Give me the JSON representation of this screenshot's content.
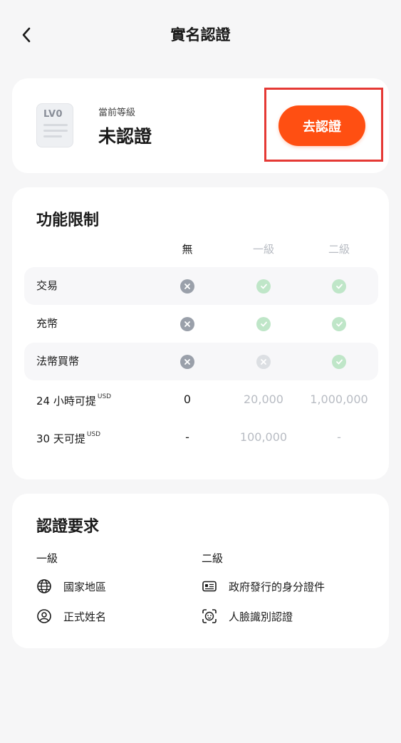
{
  "header": {
    "title": "實名認證"
  },
  "level_card": {
    "badge": "LV0",
    "current_label": "當前等級",
    "current_value": "未認證",
    "verify_button": "去認證",
    "colors": {
      "accent": "#ff4f12",
      "highlight": "#e53935"
    }
  },
  "limits": {
    "title": "功能限制",
    "columns": [
      "無",
      "一級",
      "二級"
    ],
    "rows": [
      {
        "label": "交易",
        "values": [
          "no",
          "yes",
          "yes"
        ]
      },
      {
        "label": "充幣",
        "values": [
          "no",
          "yes",
          "yes"
        ]
      },
      {
        "label": "法幣買幣",
        "values": [
          "no",
          "no",
          "yes"
        ]
      },
      {
        "label": "24 小時可提",
        "unit": "USD",
        "values": [
          "0",
          "20,000",
          "1,000,000"
        ]
      },
      {
        "label": "30 天可提",
        "unit": "USD",
        "values": [
          "-",
          "100,000",
          "-"
        ]
      }
    ]
  },
  "requirements": {
    "title": "認證要求",
    "level1": {
      "label": "一級",
      "items": [
        {
          "icon": "globe-icon",
          "text": "國家地區"
        },
        {
          "icon": "user-circle-icon",
          "text": "正式姓名"
        }
      ]
    },
    "level2": {
      "label": "二級",
      "items": [
        {
          "icon": "id-card-icon",
          "text": "政府發行的身分證件"
        },
        {
          "icon": "face-scan-icon",
          "text": "人臉識別認證"
        }
      ]
    }
  }
}
